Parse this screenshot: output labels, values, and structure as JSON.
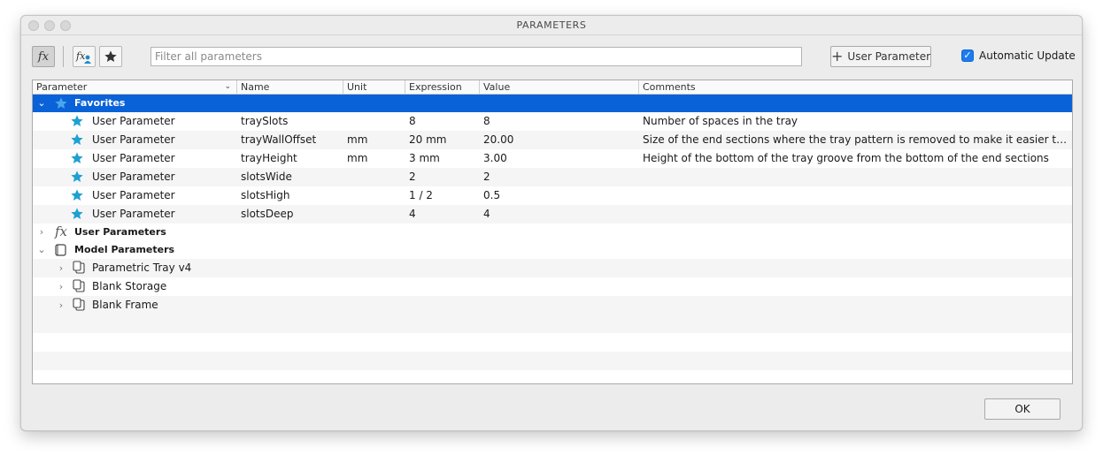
{
  "window": {
    "title": "PARAMETERS"
  },
  "toolbar": {
    "filter_placeholder": "Filter all parameters",
    "user_parameter_label": "User Parameter",
    "automatic_update_label": "Automatic Update",
    "automatic_update_checked": true
  },
  "columns": [
    "Parameter",
    "Name",
    "Unit",
    "Expression",
    "Value",
    "Comments"
  ],
  "favorites": {
    "label": "Favorites",
    "rows": [
      {
        "parameter": "User Parameter",
        "name": "traySlots",
        "unit": "",
        "expression": "8",
        "value": "8",
        "comment": "Number of spaces in the tray"
      },
      {
        "parameter": "User Parameter",
        "name": "trayWallOffset",
        "unit": "mm",
        "expression": "20 mm",
        "value": "20.00",
        "comment": "Size of the end sections where the tray pattern is removed to make it easier to pick up"
      },
      {
        "parameter": "User Parameter",
        "name": "trayHeight",
        "unit": "mm",
        "expression": "3 mm",
        "value": "3.00",
        "comment": "Height of the bottom of the tray groove from the bottom of the end sections"
      },
      {
        "parameter": "User Parameter",
        "name": "slotsWide",
        "unit": "",
        "expression": "2",
        "value": "2",
        "comment": ""
      },
      {
        "parameter": "User Parameter",
        "name": "slotsHigh",
        "unit": "",
        "expression": "1 / 2",
        "value": "0.5",
        "comment": ""
      },
      {
        "parameter": "User Parameter",
        "name": "slotsDeep",
        "unit": "",
        "expression": "4",
        "value": "4",
        "comment": ""
      }
    ]
  },
  "user_parameters": {
    "label": "User Parameters"
  },
  "model_parameters": {
    "label": "Model Parameters",
    "components": [
      "Parametric Tray v4",
      "Blank Storage",
      "Blank Frame"
    ]
  },
  "footer": {
    "ok_label": "OK"
  },
  "colors": {
    "selection": "#0a62d8",
    "star": "#1ea0d2",
    "checkbox": "#1b7cf0"
  }
}
